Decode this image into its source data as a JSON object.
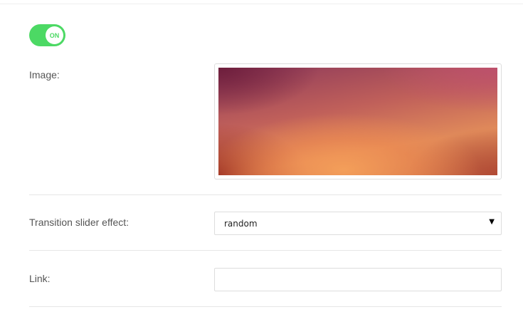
{
  "toggle": {
    "state_label": "ON",
    "enabled": true,
    "color": "#4cd964"
  },
  "image_field": {
    "label": "Image:"
  },
  "transition_field": {
    "label": "Transition slider effect:",
    "selected": "random",
    "arrow_icon": "dropdown-triangle"
  },
  "link_field": {
    "label": "Link:",
    "value": "",
    "placeholder": ""
  }
}
